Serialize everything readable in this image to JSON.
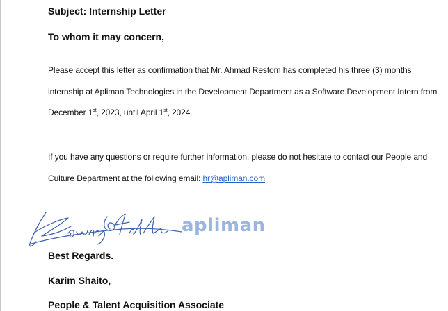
{
  "subject": "Subject: Internship Letter",
  "salutation": "To whom it may concern,",
  "paragraph1": {
    "line1": "Please accept this letter as confirmation that Mr. Ahmad Restom has completed his three (3) months",
    "line2": "internship at Apliman Technologies in the Development Department as a Software Development Intern from",
    "line3_a": "December 1",
    "line3_sup1": "st",
    "line3_b": ", 2023, until April 1",
    "line3_sup2": "st",
    "line3_c": ", 2024."
  },
  "paragraph2": {
    "line1": "If you have any questions or require further information, please do not hesitate to contact our People and",
    "line2_prefix": "Culture Department at the following email: ",
    "email": "hr@apliman.com"
  },
  "logo_text": "apliman",
  "closing": "Best Regards.",
  "signer_name": "Karim Shaito,",
  "signer_title": "People & Talent Acquisition Associate",
  "colors": {
    "signature_ink": "#3a5fb0",
    "logo": "#9ab6df",
    "link": "#2563c9"
  }
}
